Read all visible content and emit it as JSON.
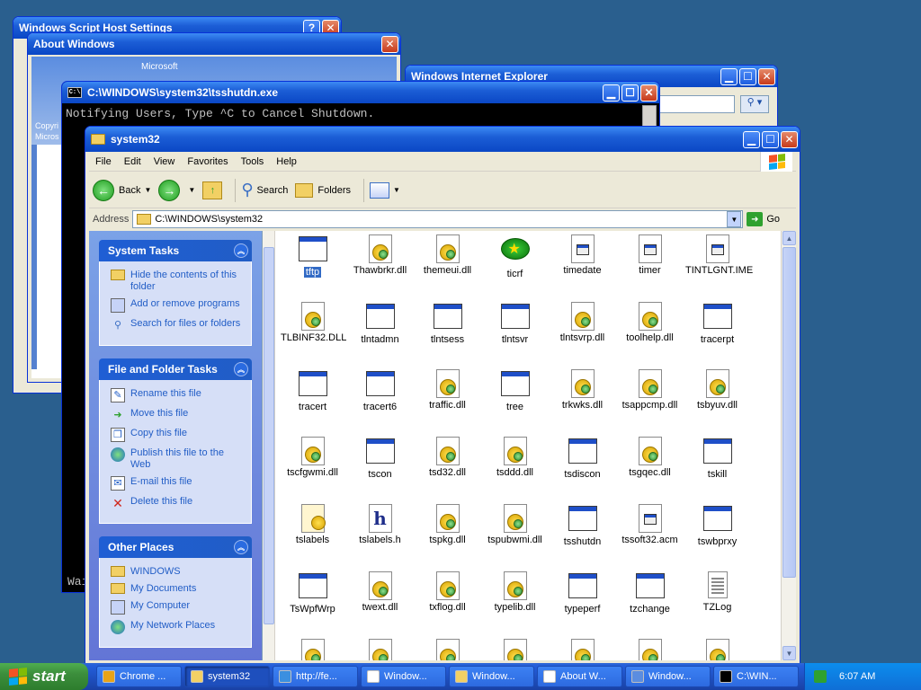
{
  "windows": {
    "wsh": {
      "title": "Windows Script Host Settings",
      "help": "?",
      "close": "✕"
    },
    "about": {
      "title": "About Windows",
      "close": "✕",
      "ms_text": "Microsoft",
      "side_text_1": "Copyri",
      "side_text_2": "Micros"
    },
    "ie": {
      "title": "Windows Internet Explorer",
      "min": "▁",
      "max": "☐",
      "close": "✕"
    },
    "cmd": {
      "title": "C:\\WINDOWS\\system32\\tsshutdn.exe",
      "min": "▁",
      "max": "☐",
      "close": "✕",
      "text": "Notifying Users, Type ^C to Cancel Shutdown.",
      "bottom_text": "Wai"
    },
    "explorer": {
      "title": "system32",
      "min": "▁",
      "max": "☐",
      "close": "✕",
      "menu": [
        "File",
        "Edit",
        "View",
        "Favorites",
        "Tools",
        "Help"
      ],
      "toolbar": {
        "back": "Back",
        "search": "Search",
        "folders": "Folders"
      },
      "address_label": "Address",
      "address_value": "C:\\WINDOWS\\system32",
      "go_label": "Go"
    }
  },
  "taskpane": {
    "system_tasks": {
      "title": "System Tasks",
      "items": [
        "Hide the contents of this folder",
        "Add or remove programs",
        "Search for files or folders"
      ]
    },
    "file_tasks": {
      "title": "File and Folder Tasks",
      "items": [
        "Rename this file",
        "Move this file",
        "Copy this file",
        "Publish this file to the Web",
        "E-mail this file",
        "Delete this file"
      ]
    },
    "other_places": {
      "title": "Other Places",
      "items": [
        "WINDOWS",
        "My Documents",
        "My Computer",
        "My Network Places"
      ]
    }
  },
  "files": [
    {
      "name": "tftp",
      "type": "exe",
      "selected": true
    },
    {
      "name": "Thawbrkr.dll",
      "type": "dll"
    },
    {
      "name": "themeui.dll",
      "type": "dll"
    },
    {
      "name": "ticrf",
      "type": "ticrf"
    },
    {
      "name": "timedate",
      "type": "doc"
    },
    {
      "name": "timer",
      "type": "doc"
    },
    {
      "name": "TINTLGNT.IME",
      "type": "doc"
    },
    {
      "name": "TLBINF32.DLL",
      "type": "dll"
    },
    {
      "name": "tlntadmn",
      "type": "exe"
    },
    {
      "name": "tlntsess",
      "type": "exe"
    },
    {
      "name": "tlntsvr",
      "type": "exe"
    },
    {
      "name": "tlntsvrp.dll",
      "type": "dll"
    },
    {
      "name": "toolhelp.dll",
      "type": "dll"
    },
    {
      "name": "tracerpt",
      "type": "exe"
    },
    {
      "name": "tracert",
      "type": "exe"
    },
    {
      "name": "tracert6",
      "type": "exe"
    },
    {
      "name": "traffic.dll",
      "type": "dll"
    },
    {
      "name": "tree",
      "type": "exe"
    },
    {
      "name": "trkwks.dll",
      "type": "dll"
    },
    {
      "name": "tsappcmp.dll",
      "type": "dll"
    },
    {
      "name": "tsbyuv.dll",
      "type": "dll"
    },
    {
      "name": "tscfgwmi.dll",
      "type": "dll"
    },
    {
      "name": "tscon",
      "type": "exe"
    },
    {
      "name": "tsd32.dll",
      "type": "dll"
    },
    {
      "name": "tsddd.dll",
      "type": "dll"
    },
    {
      "name": "tsdiscon",
      "type": "exe"
    },
    {
      "name": "tsgqec.dll",
      "type": "dll"
    },
    {
      "name": "tskill",
      "type": "exe"
    },
    {
      "name": "tslabels",
      "type": "tslabels"
    },
    {
      "name": "tslabels.h",
      "type": "h"
    },
    {
      "name": "tspkg.dll",
      "type": "dll"
    },
    {
      "name": "tspubwmi.dll",
      "type": "dll"
    },
    {
      "name": "tsshutdn",
      "type": "exe"
    },
    {
      "name": "tssoft32.acm",
      "type": "doc"
    },
    {
      "name": "tswbprxy",
      "type": "exe"
    },
    {
      "name": "TsWpfWrp",
      "type": "exe"
    },
    {
      "name": "twext.dll",
      "type": "dll"
    },
    {
      "name": "txflog.dll",
      "type": "dll"
    },
    {
      "name": "typelib.dll",
      "type": "dll"
    },
    {
      "name": "typeperf",
      "type": "exe"
    },
    {
      "name": "tzchange",
      "type": "exe"
    },
    {
      "name": "TZLog",
      "type": "log"
    },
    {
      "name": "",
      "type": "dll"
    },
    {
      "name": "",
      "type": "dll"
    },
    {
      "name": "",
      "type": "dll"
    },
    {
      "name": "",
      "type": "dll"
    },
    {
      "name": "",
      "type": "dll"
    },
    {
      "name": "",
      "type": "dll"
    },
    {
      "name": "",
      "type": "dll"
    }
  ],
  "taskbar": {
    "start_label": "start",
    "tasks": [
      {
        "label": "Chrome ...",
        "icon_color": "#e8a317"
      },
      {
        "label": "system32",
        "icon_color": "#f2d064",
        "active": true
      },
      {
        "label": "http://fe...",
        "icon_color": "#3b8fe0"
      },
      {
        "label": "Window...",
        "icon_color": "#ffffff"
      },
      {
        "label": "Window...",
        "icon_color": "#f2d064"
      },
      {
        "label": "About W...",
        "icon_color": "#ffffff"
      },
      {
        "label": "Window...",
        "icon_color": "#5b8de0"
      },
      {
        "label": "C:\\WIN...",
        "icon_color": "#000000"
      }
    ],
    "clock": "6:07 AM"
  }
}
